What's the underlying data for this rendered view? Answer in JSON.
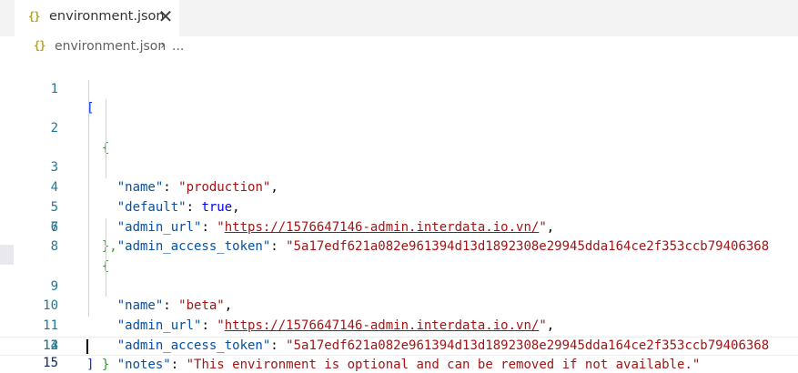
{
  "tab": {
    "icon": "{}",
    "title": "environment.json",
    "close_glyph": "✕"
  },
  "breadcrumb": {
    "icon": "{}",
    "file": "environment.json",
    "separator": "›",
    "more": "..."
  },
  "lines": [
    {
      "n": "1"
    },
    {
      "n": "2"
    },
    {
      "n": "3"
    },
    {
      "n": "4"
    },
    {
      "n": "5"
    },
    {
      "n": "6"
    },
    {
      "n": "7"
    },
    {
      "n": "8"
    },
    {
      "n": "9"
    },
    {
      "n": "10"
    },
    {
      "n": "11"
    },
    {
      "n": "12"
    },
    {
      "n": "13"
    },
    {
      "n": "14"
    },
    {
      "n": "15"
    }
  ],
  "code": {
    "open_array": "[",
    "close_array": "]",
    "open_obj": "{",
    "close_obj_comma": "},",
    "close_obj": "}",
    "quote": "\"",
    "colon": ": ",
    "comma": ",",
    "obj1": {
      "k_name": "\"name\"",
      "v_name": "\"production\"",
      "k_default": "\"default\"",
      "v_default": "true",
      "k_admin_url": "\"admin_url\"",
      "v_admin_url": "https://1576647146-admin.interdata.io.vn/",
      "k_token": "\"admin_access_token\"",
      "v_token": "\"5a17edf621a082e961394d13d1892308e29945dda164ce2f353ccb79406368"
    },
    "obj2": {
      "k_name": "\"name\"",
      "v_name": "\"beta\"",
      "k_admin_url": "\"admin_url\"",
      "v_admin_url": "https://1576647146-admin.interdata.io.vn/",
      "k_token": "\"admin_access_token\"",
      "v_token": "\"5a17edf621a082e961394d13d1892308e29945dda164ce2f353ccb79406368",
      "k_notes": "\"notes\"",
      "v_notes": "\"This environment is optional and can be removed if not available.\""
    }
  }
}
